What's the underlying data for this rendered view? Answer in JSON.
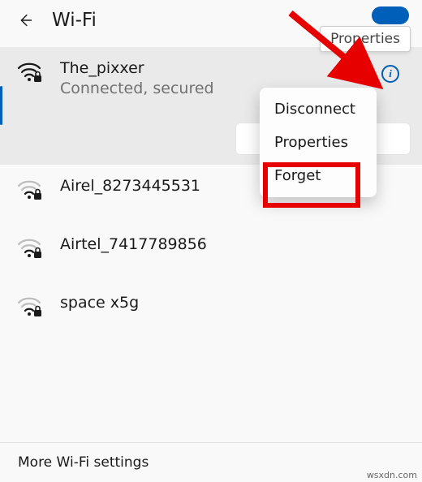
{
  "header": {
    "title": "Wi-Fi",
    "tooltip": "Properties"
  },
  "networks": [
    {
      "ssid": "The_pixxer",
      "status": "Connected, secured",
      "selected": true,
      "strong": true
    },
    {
      "ssid": "Airel_8273445531",
      "strong": false
    },
    {
      "ssid": "Airtel_7417789856",
      "strong": false
    },
    {
      "ssid": "space x5g",
      "strong": false
    }
  ],
  "menu": {
    "items": [
      "Disconnect",
      "Properties",
      "Forget"
    ]
  },
  "footer": {
    "more": "More Wi-Fi settings"
  },
  "watermark": "wsxdn.com",
  "info_glyph": "i"
}
